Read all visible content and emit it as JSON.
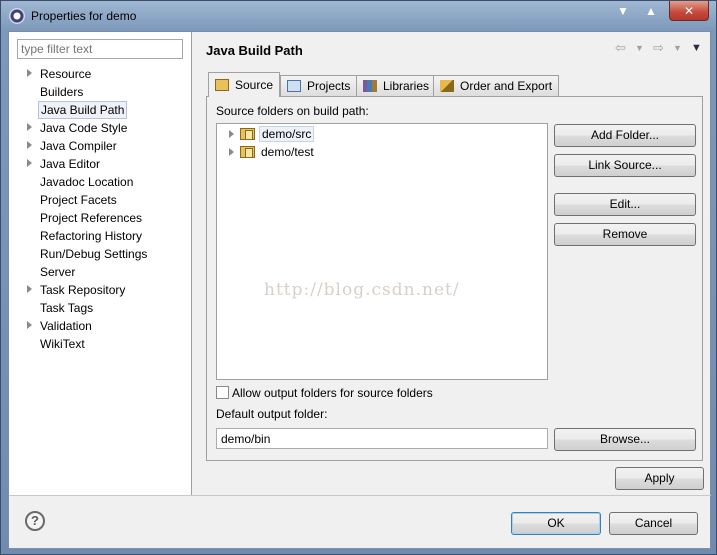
{
  "window": {
    "title": "Properties for demo",
    "close_glyph": "✕",
    "min_glyph": "▼",
    "max_glyph": "▲"
  },
  "nav": {
    "filter_placeholder": "type filter text",
    "items": [
      {
        "label": "Resource",
        "expandable": true
      },
      {
        "label": "Builders",
        "expandable": false
      },
      {
        "label": "Java Build Path",
        "expandable": false,
        "selected": true
      },
      {
        "label": "Java Code Style",
        "expandable": true
      },
      {
        "label": "Java Compiler",
        "expandable": true
      },
      {
        "label": "Java Editor",
        "expandable": true
      },
      {
        "label": "Javadoc Location",
        "expandable": false
      },
      {
        "label": "Project Facets",
        "expandable": false
      },
      {
        "label": "Project References",
        "expandable": false
      },
      {
        "label": "Refactoring History",
        "expandable": false
      },
      {
        "label": "Run/Debug Settings",
        "expandable": false
      },
      {
        "label": "Server",
        "expandable": false
      },
      {
        "label": "Task Repository",
        "expandable": true
      },
      {
        "label": "Task Tags",
        "expandable": false
      },
      {
        "label": "Validation",
        "expandable": true
      },
      {
        "label": "WikiText",
        "expandable": false
      }
    ]
  },
  "page": {
    "title": "Java Build Path",
    "tabs": [
      {
        "label": "Source",
        "active": true,
        "icon": "source-folder-icon"
      },
      {
        "label": "Projects",
        "active": false,
        "icon": "projects-icon"
      },
      {
        "label": "Libraries",
        "active": false,
        "icon": "libraries-icon"
      },
      {
        "label": "Order and Export",
        "active": false,
        "icon": "order-export-icon"
      }
    ],
    "source_label": "Source folders on build path:",
    "source_folders": [
      {
        "label": "demo/src",
        "selected": true
      },
      {
        "label": "demo/test",
        "selected": false
      }
    ],
    "buttons": {
      "add_folder": "Add Folder...",
      "link_source": "Link Source...",
      "edit": "Edit...",
      "remove": "Remove",
      "browse": "Browse...",
      "apply": "Apply"
    },
    "allow_output_label": "Allow output folders for source folders",
    "allow_output_checked": false,
    "default_output_label": "Default output folder:",
    "default_output_value": "demo/bin",
    "watermark": "http://blog.csdn.net/"
  },
  "footer": {
    "help": "?",
    "ok": "OK",
    "cancel": "Cancel"
  },
  "colors": {
    "accent": "#3c7fb1",
    "selection": "#eef2f8"
  }
}
